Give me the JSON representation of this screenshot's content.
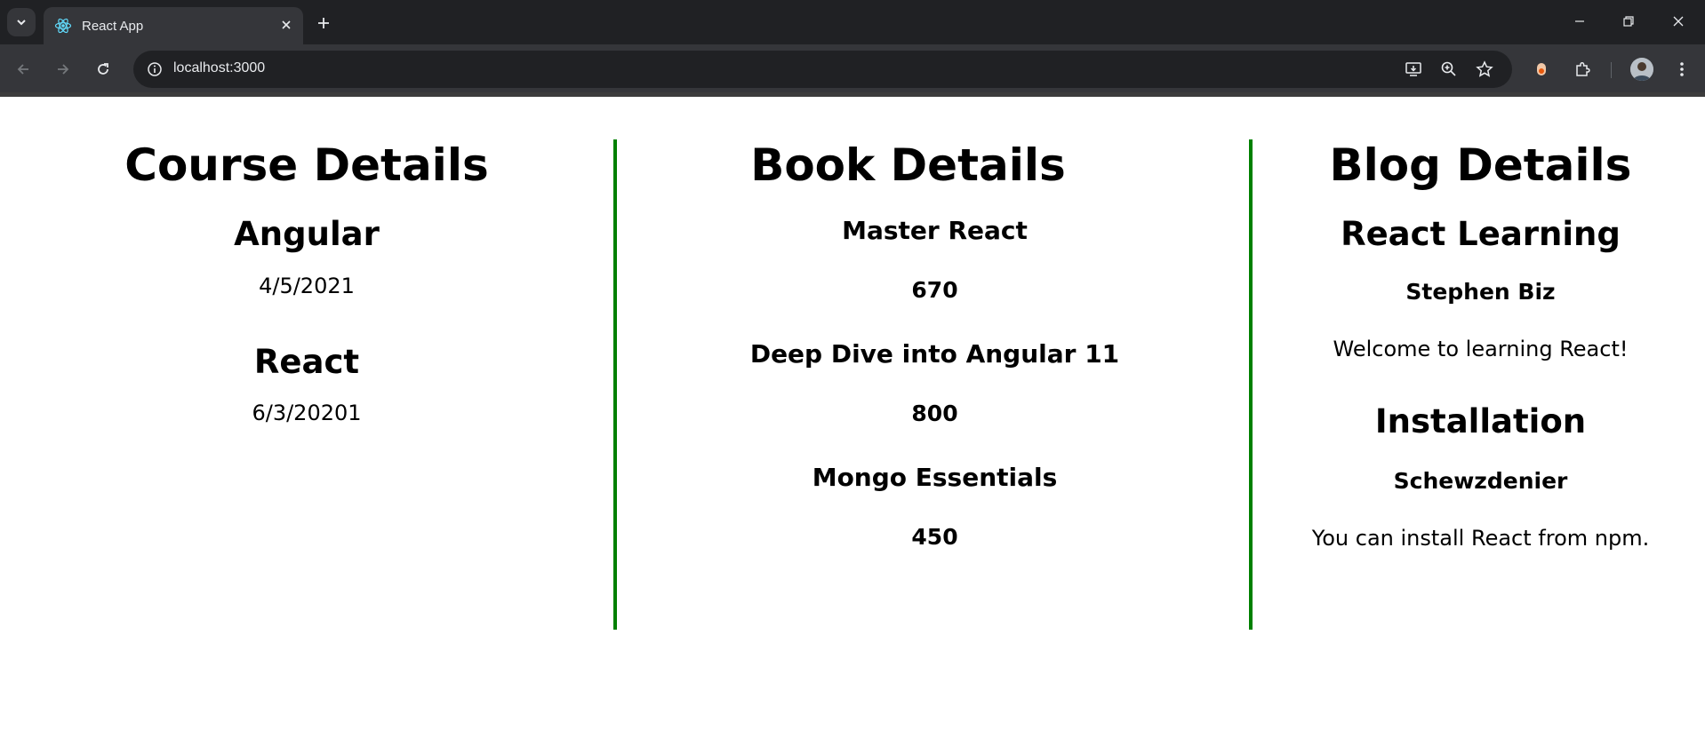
{
  "browser": {
    "tab_title": "React App",
    "url": "localhost:3000"
  },
  "course": {
    "heading": "Course Details",
    "items": [
      {
        "name": "Angular",
        "date": "4/5/2021"
      },
      {
        "name": "React",
        "date": "6/3/20201"
      }
    ]
  },
  "book": {
    "heading": "Book Details",
    "items": [
      {
        "name": "Master React",
        "price": "670"
      },
      {
        "name": "Deep Dive into Angular 11",
        "price": "800"
      },
      {
        "name": "Mongo Essentials",
        "price": "450"
      }
    ]
  },
  "blog": {
    "heading": "Blog Details",
    "items": [
      {
        "title": "React Learning",
        "author": "Stephen Biz",
        "content": "Welcome to learning React!"
      },
      {
        "title": "Installation",
        "author": "Schewzdenier",
        "content": "You can install React from npm."
      }
    ]
  },
  "colors": {
    "divider": "#008000",
    "chrome_dark": "#202124",
    "chrome_toolbar": "#35363a"
  }
}
